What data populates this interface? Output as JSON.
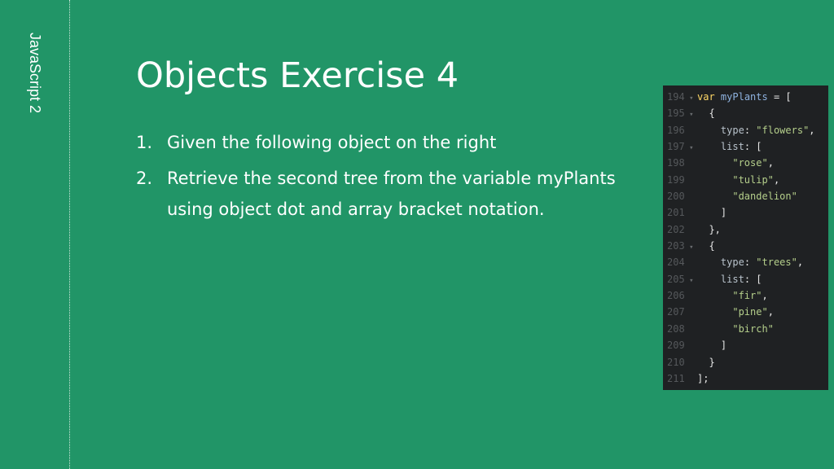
{
  "sidebar": {
    "label": "JavaScript 2"
  },
  "slide": {
    "title": "Objects Exercise 4",
    "steps": [
      {
        "num": "1.",
        "text": "Given the following object on the right"
      },
      {
        "num": "2.",
        "text": "Retrieve the second tree from the variable myPlants using object dot and array bracket notation."
      }
    ]
  },
  "code": {
    "lines": [
      {
        "n": "194",
        "fold": true,
        "indent": "",
        "parts": [
          {
            "t": "var",
            "c": "kw"
          },
          {
            "t": " ",
            "c": ""
          },
          {
            "t": "myPlants",
            "c": "var"
          },
          {
            "t": " = [",
            "c": ""
          }
        ]
      },
      {
        "n": "195",
        "fold": true,
        "indent": "  ",
        "parts": [
          {
            "t": "{",
            "c": ""
          }
        ]
      },
      {
        "n": "196",
        "fold": false,
        "indent": "    ",
        "parts": [
          {
            "t": "type",
            "c": "prop"
          },
          {
            "t": ": ",
            "c": ""
          },
          {
            "t": "\"flowers\"",
            "c": "str"
          },
          {
            "t": ",",
            "c": ""
          }
        ]
      },
      {
        "n": "197",
        "fold": true,
        "indent": "    ",
        "parts": [
          {
            "t": "list",
            "c": "prop"
          },
          {
            "t": ": [",
            "c": ""
          }
        ]
      },
      {
        "n": "198",
        "fold": false,
        "indent": "      ",
        "parts": [
          {
            "t": "\"rose\"",
            "c": "str"
          },
          {
            "t": ",",
            "c": ""
          }
        ]
      },
      {
        "n": "199",
        "fold": false,
        "indent": "      ",
        "parts": [
          {
            "t": "\"tulip\"",
            "c": "str"
          },
          {
            "t": ",",
            "c": ""
          }
        ]
      },
      {
        "n": "200",
        "fold": false,
        "indent": "      ",
        "parts": [
          {
            "t": "\"dandelion\"",
            "c": "str"
          }
        ]
      },
      {
        "n": "201",
        "fold": false,
        "indent": "    ",
        "parts": [
          {
            "t": "]",
            "c": ""
          }
        ]
      },
      {
        "n": "202",
        "fold": false,
        "indent": "  ",
        "parts": [
          {
            "t": "},",
            "c": ""
          }
        ]
      },
      {
        "n": "203",
        "fold": true,
        "indent": "  ",
        "parts": [
          {
            "t": "{",
            "c": ""
          }
        ]
      },
      {
        "n": "204",
        "fold": false,
        "indent": "    ",
        "parts": [
          {
            "t": "type",
            "c": "prop"
          },
          {
            "t": ": ",
            "c": ""
          },
          {
            "t": "\"trees\"",
            "c": "str"
          },
          {
            "t": ",",
            "c": ""
          }
        ]
      },
      {
        "n": "205",
        "fold": true,
        "indent": "    ",
        "parts": [
          {
            "t": "list",
            "c": "prop"
          },
          {
            "t": ": [",
            "c": ""
          }
        ]
      },
      {
        "n": "206",
        "fold": false,
        "indent": "      ",
        "parts": [
          {
            "t": "\"fir\"",
            "c": "str"
          },
          {
            "t": ",",
            "c": ""
          }
        ]
      },
      {
        "n": "207",
        "fold": false,
        "indent": "      ",
        "parts": [
          {
            "t": "\"pine\"",
            "c": "str"
          },
          {
            "t": ",",
            "c": ""
          }
        ]
      },
      {
        "n": "208",
        "fold": false,
        "indent": "      ",
        "parts": [
          {
            "t": "\"birch\"",
            "c": "str"
          }
        ]
      },
      {
        "n": "209",
        "fold": false,
        "indent": "    ",
        "parts": [
          {
            "t": "]",
            "c": ""
          }
        ]
      },
      {
        "n": "210",
        "fold": false,
        "indent": "  ",
        "parts": [
          {
            "t": "}",
            "c": ""
          }
        ]
      },
      {
        "n": "211",
        "fold": false,
        "indent": "",
        "parts": [
          {
            "t": "];",
            "c": ""
          }
        ]
      }
    ]
  }
}
